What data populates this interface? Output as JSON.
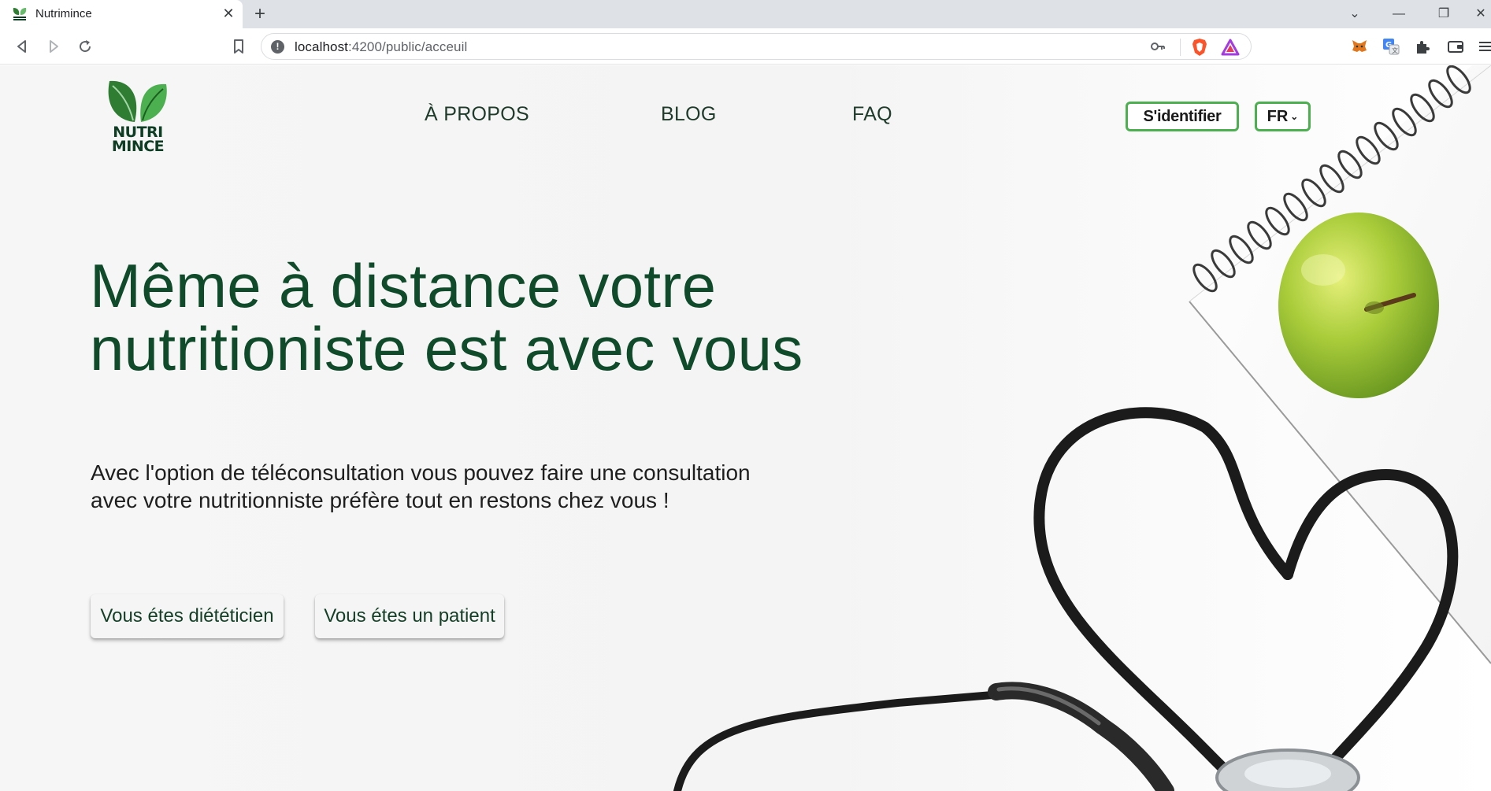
{
  "browser": {
    "tab_title": "Nutrimince",
    "tab_close": "✕",
    "new_tab": "+",
    "url_host": "localhost",
    "url_rest": ":4200/public/acceuil",
    "window_controls": {
      "chevron": "⌄",
      "minimize": "—",
      "restore": "❐",
      "close": "✕"
    },
    "icons": [
      "back-icon",
      "forward-icon",
      "reload-icon",
      "bookmark-icon",
      "info-icon",
      "key-icon",
      "brave-shield-icon",
      "brave-rewards-icon",
      "metamask-icon",
      "translate-icon",
      "extensions-icon",
      "wallet-icon",
      "menu-icon"
    ]
  },
  "header": {
    "logo_line1": "NUTRI",
    "logo_line2": "MINCE",
    "nav": [
      {
        "label": "À PROPOS"
      },
      {
        "label": "BLOG"
      },
      {
        "label": "FAQ"
      }
    ],
    "login_label": "S'identifier",
    "lang_label": "FR"
  },
  "hero": {
    "title_line1": "Même à distance votre",
    "title_line2": "nutritioniste est avec vous",
    "subtitle_line1": "Avec l'option de téléconsultation vous pouvez faire une consultation",
    "subtitle_line2": "avec votre nutritionniste préfère tout en restons chez vous !",
    "cta_dietitian": "Vous étes diététicien",
    "cta_patient": "Vous étes un patient"
  },
  "colors": {
    "brand_green": "#0f4a2a",
    "accent_green": "#4caf50",
    "leaf_green": "#3d8b2f"
  }
}
